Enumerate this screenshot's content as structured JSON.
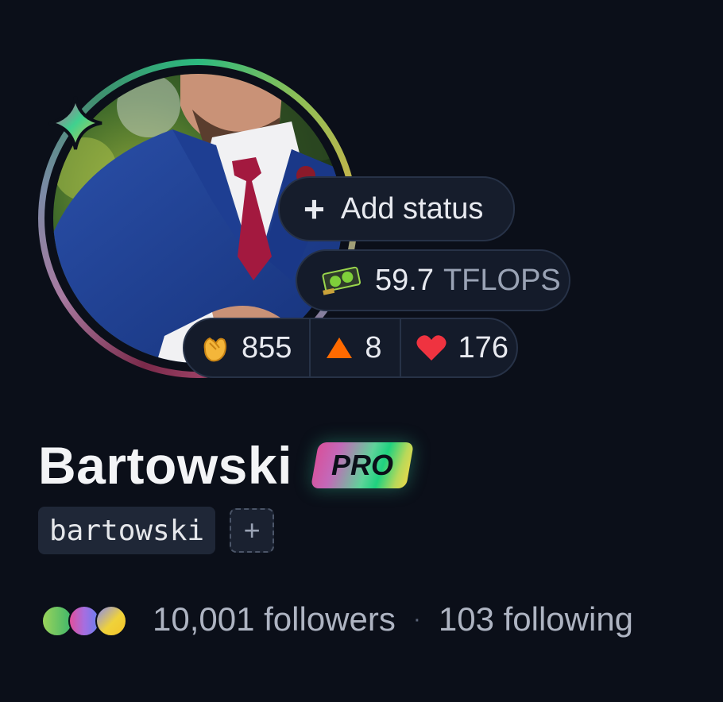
{
  "profile": {
    "display_name": "Bartowski",
    "badge": "PRO",
    "handle": "bartowski",
    "add_handle_label": "+"
  },
  "status": {
    "add_label": "Add status",
    "add_icon": "plus-icon"
  },
  "compute": {
    "value": "59.7",
    "unit": "TFLOPS",
    "icon": "gpu-icon"
  },
  "reactions": [
    {
      "icon": "clap-icon",
      "count": "855"
    },
    {
      "icon": "upvote-icon",
      "count": "8"
    },
    {
      "icon": "heart-icon",
      "count": "176"
    }
  ],
  "social": {
    "followers": "10,001 followers",
    "separator": "·",
    "following": "103 following"
  },
  "colors": {
    "background": "#0b0f19",
    "pill_bg": "#141b2a",
    "pill_border": "#273247",
    "upvote": "#ff6a00",
    "heart": "#ef3340"
  }
}
